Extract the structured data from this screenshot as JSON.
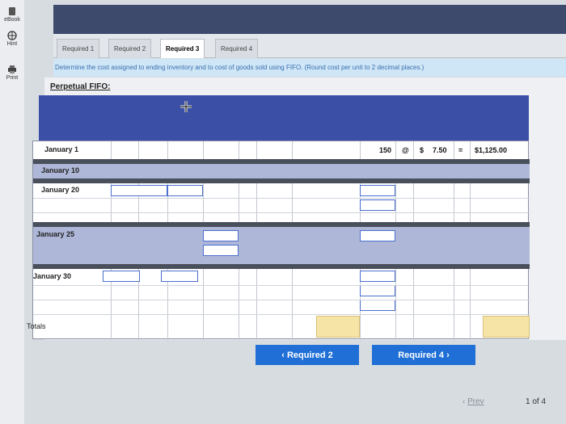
{
  "rail": {
    "ebook_label": "eBook",
    "print_label": "Print",
    "hint_label": "Hint"
  },
  "tabs": [
    {
      "label": "Required 1"
    },
    {
      "label": "Required 2"
    },
    {
      "label": "Required 3"
    },
    {
      "label": "Required 4"
    }
  ],
  "instruction": "Determine the cost assigned to ending inventory and to cost of goods sold using FIFO. (Round cost per unit to 2 decimal places.)",
  "section_title": "Perpetual FIFO:",
  "rows": [
    {
      "label": "January 1"
    },
    {
      "label": "January 10"
    },
    {
      "label": "January 20"
    },
    {
      "label": "January 25"
    },
    {
      "label": "January 30"
    }
  ],
  "balance": {
    "units": "150",
    "at": "@",
    "dollar": "$",
    "cost": "7.50",
    "eq": "=",
    "total": "$1,125.00"
  },
  "totals_label": "Totals",
  "buttons": {
    "prev_required": "Required 2",
    "next_required": "Required 4"
  },
  "footer": {
    "prev": "Prev",
    "page": "1 of 4"
  }
}
